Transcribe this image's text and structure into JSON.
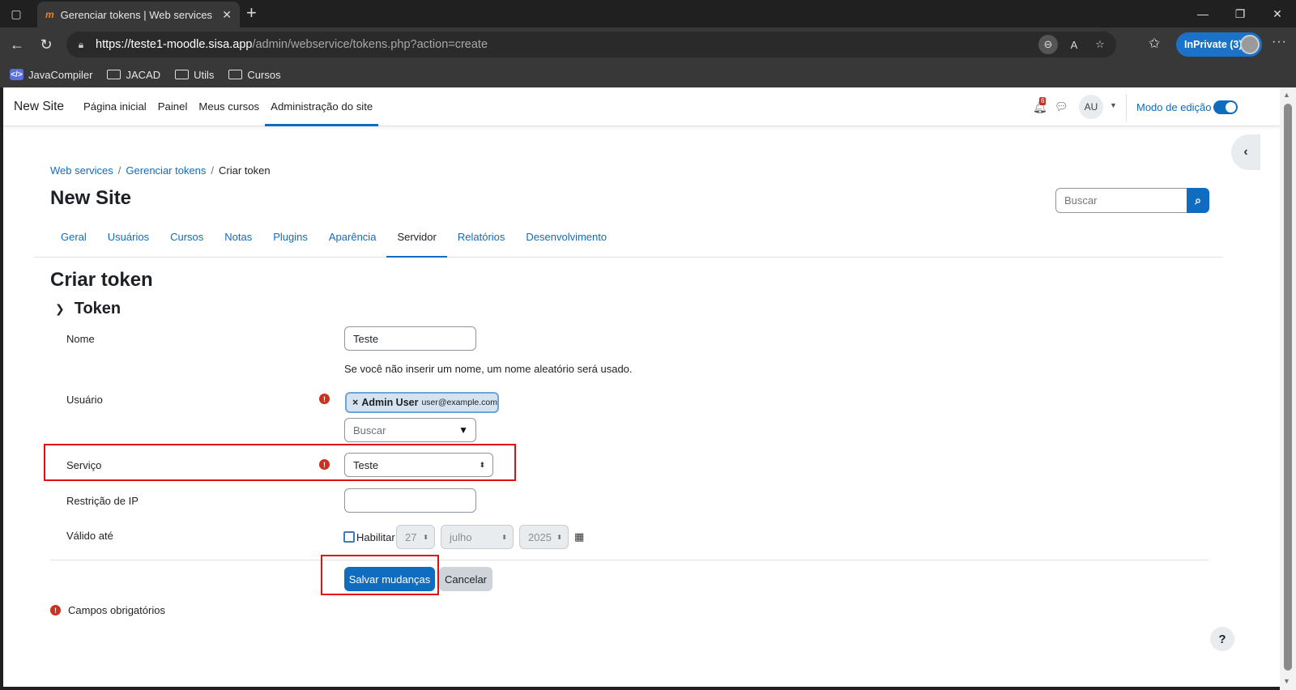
{
  "browser": {
    "tab_title": "Gerenciar tokens | Web services |",
    "tab_favicon": "m",
    "url_host": "https://teste1-moodle.sisa.app",
    "url_path": "/admin/webservice/tokens.php?action=create",
    "inprivate_label": "InPrivate (3)",
    "bookmarks": [
      {
        "label": "JavaCompiler",
        "icon": "code-icon"
      },
      {
        "label": "JACAD",
        "icon": "folder-icon"
      },
      {
        "label": "Utils",
        "icon": "folder-icon"
      },
      {
        "label": "Cursos",
        "icon": "folder-icon"
      }
    ]
  },
  "navbar": {
    "brand": "New Site",
    "items": [
      "Página inicial",
      "Painel",
      "Meus cursos",
      "Administração do site"
    ],
    "active_index": 3,
    "notification_count": "6",
    "avatar_initials": "AU",
    "edit_mode_label": "Modo de edição",
    "edit_mode_on": true
  },
  "breadcrumb": {
    "items": [
      "Web services",
      "Gerenciar tokens",
      "Criar token"
    ]
  },
  "header": {
    "site_title": "New Site",
    "search_placeholder": "Buscar"
  },
  "admin_tabs": {
    "items": [
      "Geral",
      "Usuários",
      "Cursos",
      "Notas",
      "Plugins",
      "Aparência",
      "Servidor",
      "Relatórios",
      "Desenvolvimento"
    ],
    "active_index": 6
  },
  "form": {
    "page_title": "Criar token",
    "section_title": "Token",
    "name_label": "Nome",
    "name_value": "Teste",
    "name_help": "Se você não inserir um nome, um nome aleatório será usado.",
    "user_label": "Usuário",
    "user_tag_remove": "×",
    "user_tag_name": "Admin User",
    "user_tag_email": "user@example.com",
    "user_search_placeholder": "Buscar",
    "service_label": "Serviço",
    "service_value": "Teste",
    "ip_label": "Restrição de IP",
    "ip_value": "",
    "valid_label": "Válido até",
    "valid_enable_label": "Habilitar",
    "valid_day": "27",
    "valid_month": "julho",
    "valid_year": "2025",
    "save_label": "Salvar mudanças",
    "cancel_label": "Cancelar",
    "required_note": "Campos obrigatórios"
  },
  "colors": {
    "primary": "#0f6cbf",
    "required": "#ca3120",
    "highlight_box": "#e01010"
  }
}
